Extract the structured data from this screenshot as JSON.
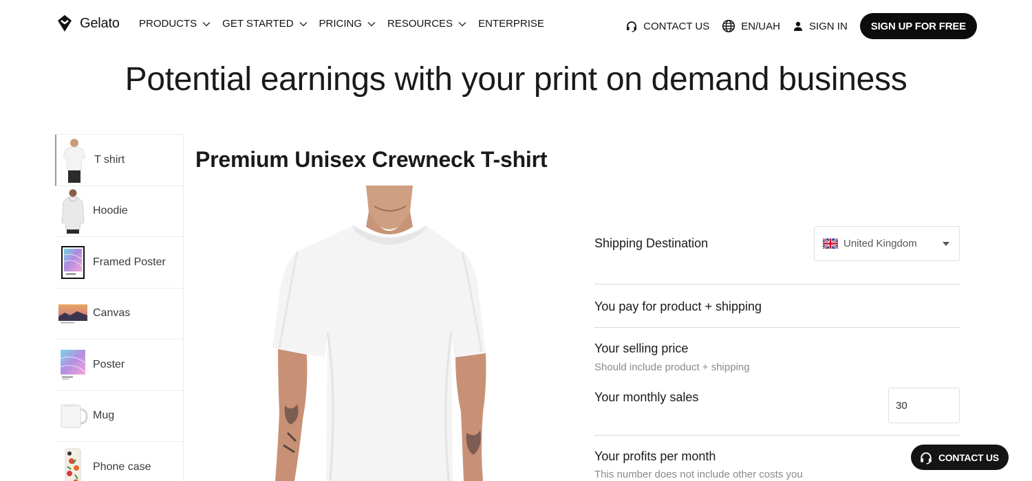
{
  "header": {
    "logo_text": "Gelato",
    "nav": [
      {
        "label": "PRODUCTS",
        "has_dropdown": true
      },
      {
        "label": "GET STARTED",
        "has_dropdown": true
      },
      {
        "label": "PRICING",
        "has_dropdown": true
      },
      {
        "label": "RESOURCES",
        "has_dropdown": true
      },
      {
        "label": "ENTERPRISE",
        "has_dropdown": false
      }
    ],
    "contact_label": "CONTACT US",
    "locale_label": "EN/UAH",
    "signin_label": "SIGN IN",
    "signup_label": "SIGN UP FOR FREE"
  },
  "hero": {
    "title": "Potential earnings with your print on demand business"
  },
  "sidebar": {
    "items": [
      {
        "label": "T shirt",
        "icon": "tshirt-thumbnail",
        "active": true
      },
      {
        "label": "Hoodie",
        "icon": "hoodie-thumbnail",
        "active": false
      },
      {
        "label": "Framed Poster",
        "icon": "framed-poster-thumbnail",
        "active": false
      },
      {
        "label": "Canvas",
        "icon": "canvas-thumbnail",
        "active": false
      },
      {
        "label": "Poster",
        "icon": "poster-thumbnail",
        "active": false
      },
      {
        "label": "Mug",
        "icon": "mug-thumbnail",
        "active": false
      },
      {
        "label": "Phone case",
        "icon": "phone-case-thumbnail",
        "active": false
      }
    ]
  },
  "product": {
    "title": "Premium Unisex Crewneck T-shirt",
    "image": "white-tshirt-model-photo"
  },
  "calculator": {
    "shipping_label": "Shipping Destination",
    "shipping_value": "United Kingdom",
    "shipping_flag": "uk-flag-icon",
    "pay_label": "You pay for product + shipping",
    "selling_label": "Your selling price",
    "selling_sub": "Should include product + shipping",
    "sales_label": "Your monthly sales",
    "sales_value": "30",
    "profit_label": "Your profits per month",
    "profit_sub": "This number does not include other costs you"
  },
  "floating": {
    "contact_label": "CONTACT US"
  },
  "colors": {
    "brand_dark": "#0c0c0c",
    "text": "#121212",
    "muted": "#8a8a8a",
    "border": "#dedede"
  }
}
